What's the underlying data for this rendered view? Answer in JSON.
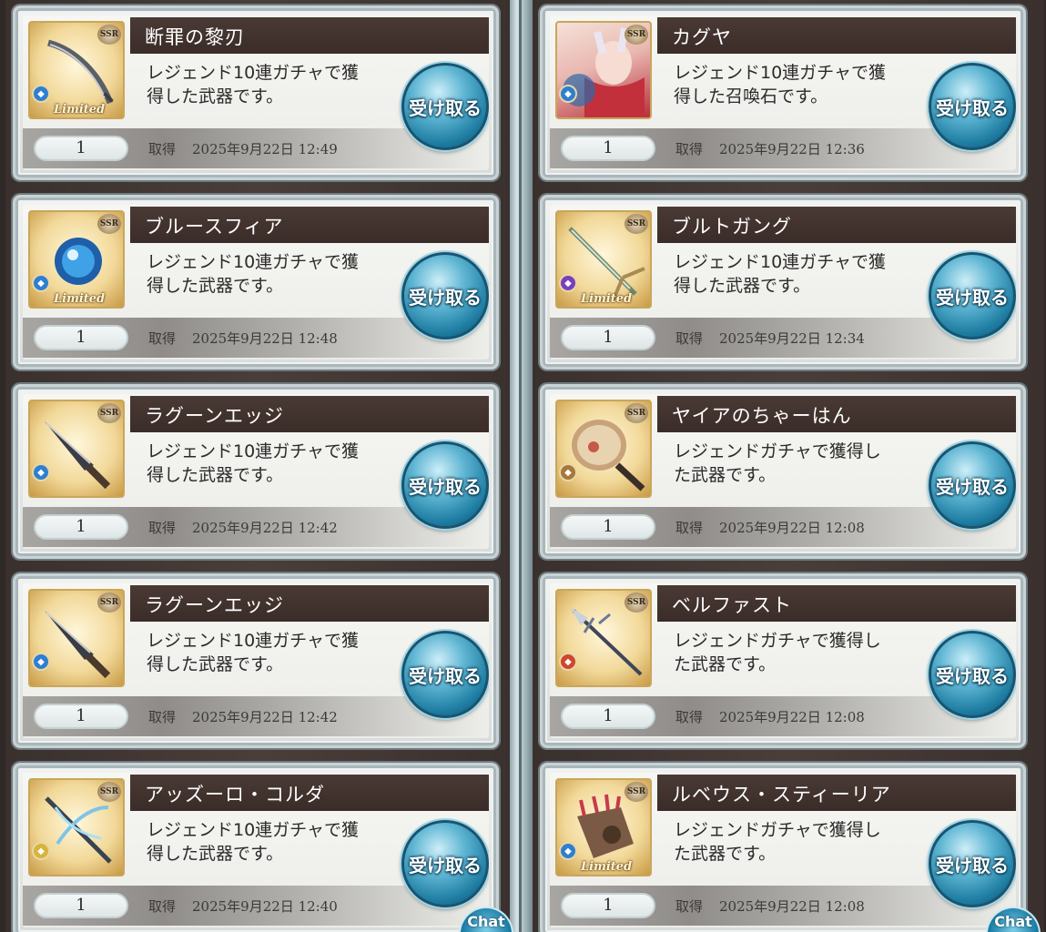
{
  "common": {
    "ssr_label": "SSR",
    "receive_label": "受け取る",
    "acquired_label": "取得",
    "limited_label": "Limited",
    "chat_label": "Chat"
  },
  "left": [
    {
      "name": "断罪の黎刃",
      "desc_line1": "レジェンド10連ガチャで獲",
      "desc_line2": "得した武器です。",
      "qty": "1",
      "date": "2025年9月22日 12:49",
      "limited": true,
      "element": "water",
      "art": "scimitar-icon"
    },
    {
      "name": "ブルースフィア",
      "desc_line1": "レジェンド10連ガチャで獲",
      "desc_line2": "得した武器です。",
      "qty": "1",
      "date": "2025年9月22日 12:48",
      "limited": true,
      "element": "water",
      "art": "blue-orb-icon"
    },
    {
      "name": "ラグーンエッジ",
      "desc_line1": "レジェンド10連ガチャで獲",
      "desc_line2": "得した武器です。",
      "qty": "1",
      "date": "2025年9月22日 12:42",
      "limited": false,
      "element": "water",
      "art": "dagger-icon"
    },
    {
      "name": "ラグーンエッジ",
      "desc_line1": "レジェンド10連ガチャで獲",
      "desc_line2": "得した武器です。",
      "qty": "1",
      "date": "2025年9月22日 12:42",
      "limited": false,
      "element": "water",
      "art": "dagger-icon"
    },
    {
      "name": "アッズーロ・コルダ",
      "desc_line1": "レジェンド10連ガチャで獲",
      "desc_line2": "得した武器です。",
      "qty": "1",
      "date": "2025年9月22日 12:40",
      "limited": false,
      "element": "light",
      "art": "crossbow-icon"
    }
  ],
  "right": [
    {
      "name": "カグヤ",
      "desc_line1": "レジェンド10連ガチャで獲",
      "desc_line2": "得した召喚石です。",
      "qty": "1",
      "date": "2025年9月22日 12:36",
      "limited": false,
      "element": "water",
      "art": "summon-portrait-icon"
    },
    {
      "name": "ブルトガング",
      "desc_line1": "レジェンド10連ガチャで獲",
      "desc_line2": "得した武器です。",
      "qty": "1",
      "date": "2025年9月22日 12:34",
      "limited": true,
      "element": "dark",
      "art": "sword-icon"
    },
    {
      "name": "ヤイアのちゃーはん",
      "desc_line1": "レジェンドガチャで獲得し",
      "desc_line2": "た武器です。",
      "qty": "1",
      "date": "2025年9月22日 12:08",
      "limited": false,
      "element": "earth",
      "art": "frying-pan-icon"
    },
    {
      "name": "ベルファスト",
      "desc_line1": "レジェンドガチャで獲得し",
      "desc_line2": "た武器です。",
      "qty": "1",
      "date": "2025年9月22日 12:08",
      "limited": false,
      "element": "fire",
      "art": "spear-icon"
    },
    {
      "name": "ルベウス・スティーリア",
      "desc_line1": "レジェンドガチャで獲得し",
      "desc_line2": "た武器です。",
      "qty": "1",
      "date": "2025年9月22日 12:08",
      "limited": true,
      "element": "water",
      "art": "gauntlet-icon"
    }
  ],
  "colors": {
    "water": "#2e7fd0",
    "light": "#d9b43a",
    "dark": "#7a3fb8",
    "earth": "#a8773a",
    "fire": "#d0462e"
  }
}
